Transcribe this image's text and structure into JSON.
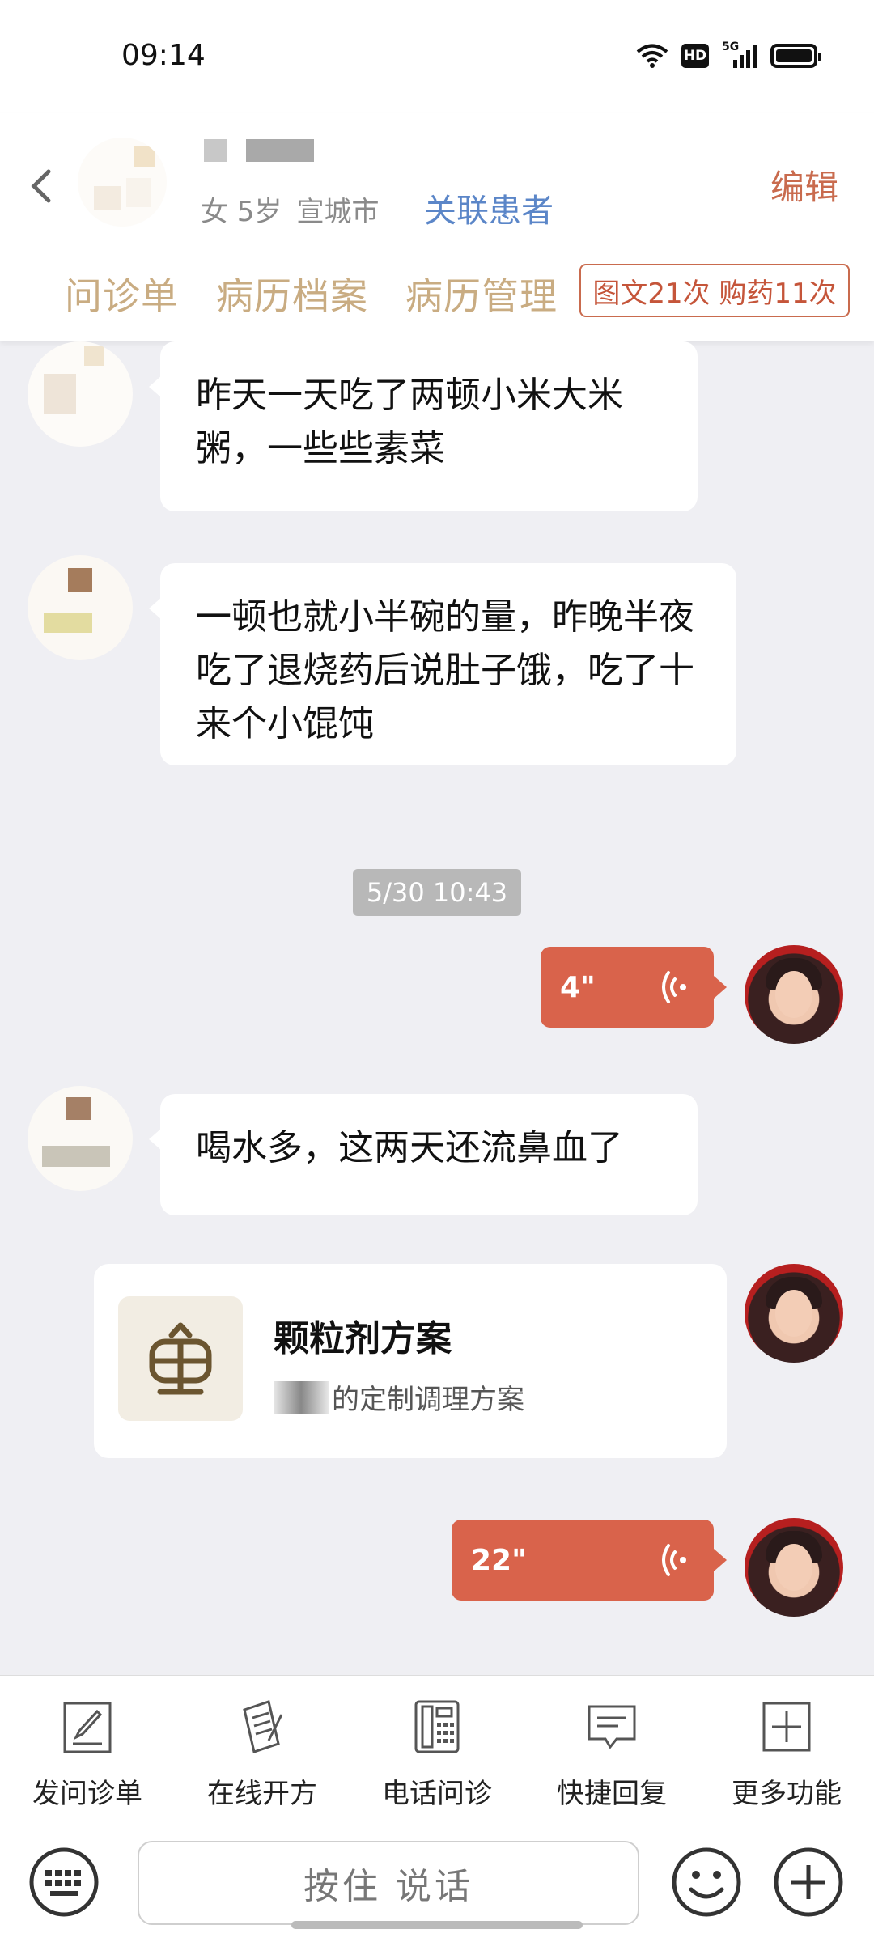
{
  "status_bar": {
    "time": "09:14",
    "network": "5G",
    "hd": "HD"
  },
  "header": {
    "gender_age": "女 5岁",
    "city": "宣城市",
    "link_patient": "关联患者",
    "edit": "编辑",
    "tabs": [
      "问诊单",
      "病历档案",
      "病历管理"
    ],
    "counts": "图文21次 购药11次"
  },
  "messages": [
    {
      "side": "left",
      "text": "昨天一天吃了两顿小米大米粥，一些些素菜"
    },
    {
      "side": "left",
      "text": "一顿也就小半碗的量，昨晚半夜吃了退烧药后说肚子饿，吃了十来个小馄饨"
    },
    {
      "type": "timestamp",
      "text": "5/30 10:43"
    },
    {
      "side": "right",
      "type": "voice",
      "duration": "4\""
    },
    {
      "side": "left",
      "text": "喝水多，这两天还流鼻血了"
    },
    {
      "side": "right",
      "type": "card",
      "title": "颗粒剂方案",
      "subtitle": "的定制调理方案"
    },
    {
      "side": "right",
      "type": "voice",
      "duration": "22\""
    }
  ],
  "toolbar": [
    {
      "label": "发问诊单",
      "icon": "form-edit-icon"
    },
    {
      "label": "在线开方",
      "icon": "prescription-icon"
    },
    {
      "label": "电话问诊",
      "icon": "phone-icon"
    },
    {
      "label": "快捷回复",
      "icon": "quick-reply-icon"
    },
    {
      "label": "更多功能",
      "icon": "plus-square-icon"
    }
  ],
  "input": {
    "hold_to_talk": "按住 说话"
  },
  "colors": {
    "accent": "#d9634b",
    "tab": "#c9ac82",
    "link": "#5b86c8"
  }
}
